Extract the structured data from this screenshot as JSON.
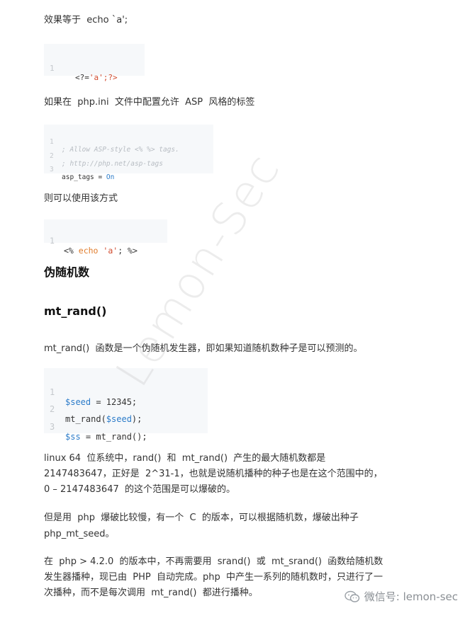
{
  "paragraphs": {
    "p1": "效果等于  echo `a';",
    "p2": "如果在  php.ini  文件中配置允许  ASP  风格的标签",
    "p3": "则可以使用该方式",
    "p4": "mt_rand()  函数是一个伪随机发生器，即如果知道随机数种子是可以预测的。",
    "p5_l1": "linux 64  位系统中，rand()  和  mt_rand()  产生的最大随机数都是",
    "p5_l2": "2147483647，正好是  2^31-1，也就是说随机播种的种子也是在这个范围中的，",
    "p5_l3": "0 – 2147483647  的这个范围是可以爆破的。",
    "p6_l1": "但是用  php  爆破比较慢，有一个  C  的版本，可以根据随机数，爆破出种子",
    "p6_l2": "php_mt_seed。",
    "p7_l1": "在  php > 4.2.0  的版本中，不再需要用  srand()  或  mt_srand()  函数给随机数",
    "p7_l2": "发生器播种，现已由  PHP  自动完成。php  中产生一系列的随机数时，只进行了一",
    "p7_l3": "次播种，而不是每次调用  mt_rand()  都进行播种。"
  },
  "headings": {
    "h1": "伪随机数",
    "h2": "mt_rand()"
  },
  "code1": {
    "lines": [
      {
        "n": "1",
        "a": "<?=",
        "b": "'a'",
        "c": ";?>"
      }
    ]
  },
  "code2": {
    "lines": [
      {
        "n": "1",
        "comment": "; Allow ASP-style <% %> tags."
      },
      {
        "n": "2",
        "comment": "; http://php.net/asp-tags"
      },
      {
        "n": "3",
        "a": "asp_tags = ",
        "b": "On"
      }
    ]
  },
  "code3": {
    "lines": [
      {
        "n": "1",
        "a": "<% ",
        "kw": "echo",
        "sp": " ",
        "str": "'a'",
        "c": "; %>"
      }
    ]
  },
  "code4": {
    "lines": [
      {
        "n": "1",
        "var": "$seed",
        "rest": " = 12345;"
      },
      {
        "n": "2",
        "pre": "mt_rand(",
        "var": "$seed",
        "rest": ");"
      },
      {
        "n": "3",
        "var": "$ss",
        "rest": " = mt_rand();"
      }
    ]
  },
  "watermark": "Lemon-Sec",
  "footer": {
    "text": "微信号: lemon-sec",
    "icon": "wechat-icon"
  }
}
